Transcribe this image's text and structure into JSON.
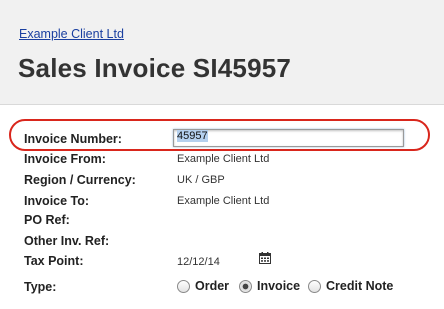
{
  "header": {
    "client_link": "Example Client Ltd",
    "title": "Sales Invoice SI45957"
  },
  "form": {
    "invoice_number": {
      "label": "Invoice Number:",
      "value": "45957",
      "selected": true
    },
    "invoice_from": {
      "label": "Invoice From:",
      "value": "Example Client Ltd"
    },
    "region_currency": {
      "label": "Region /  Currency:",
      "value": "UK / GBP"
    },
    "invoice_to": {
      "label": "Invoice To:",
      "value": "Example Client Ltd"
    },
    "po_ref": {
      "label": "PO Ref:",
      "value": ""
    },
    "other_ref": {
      "label": "Other Inv. Ref:",
      "value": ""
    },
    "tax_point": {
      "label": "Tax Point:",
      "value": "12/12/14",
      "icon": "calendar-icon"
    },
    "type": {
      "label": "Type:",
      "options": [
        "Order",
        "Invoice",
        "Credit Note"
      ],
      "selected": "Invoice"
    }
  },
  "colors": {
    "highlight": "#d9261c",
    "link": "#1a3fa0",
    "header_bg": "#f1f1f1",
    "selection": "#b5d0ee"
  }
}
